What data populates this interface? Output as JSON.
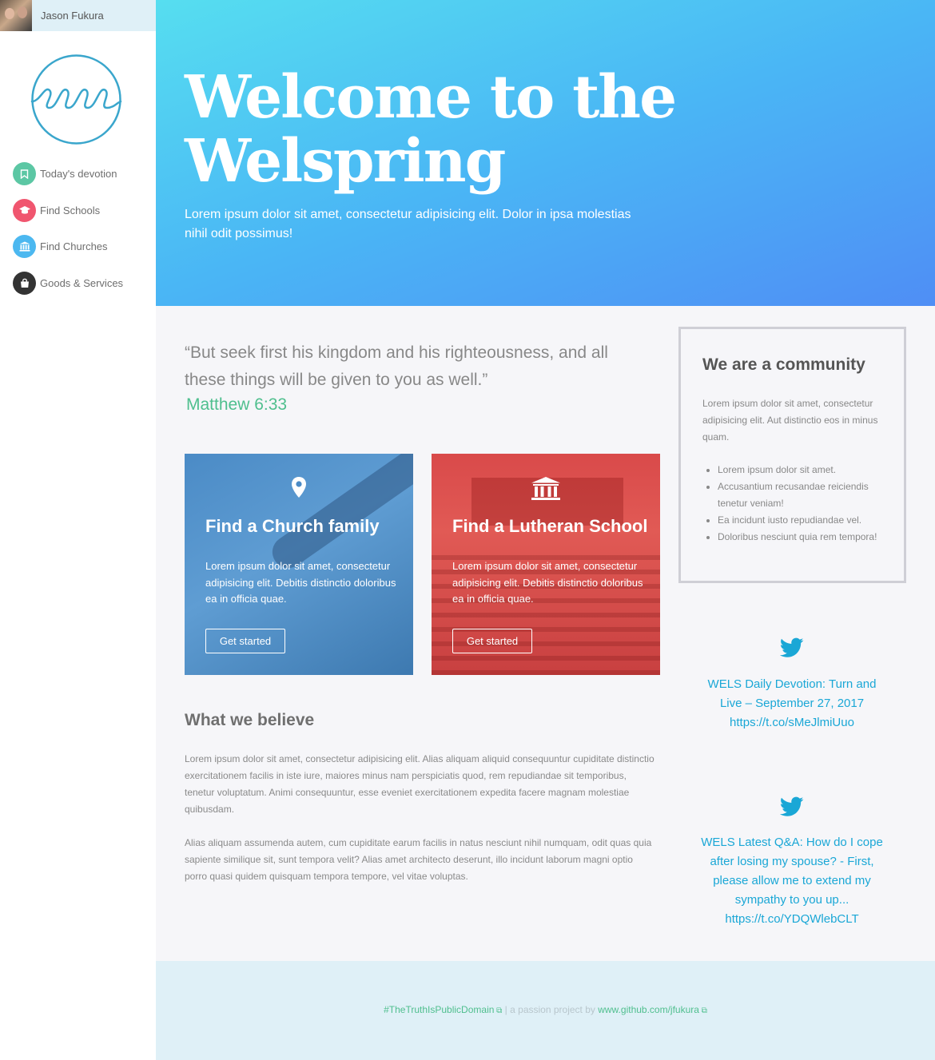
{
  "user": {
    "name": "Jason Fukura"
  },
  "nav": {
    "items": [
      {
        "label": "Today's devotion",
        "icon": "bookmark-icon",
        "color": "#5cc7a4"
      },
      {
        "label": "Find Schools",
        "icon": "graduation-cap-icon",
        "color": "#f0566f"
      },
      {
        "label": "Find Churches",
        "icon": "institution-icon",
        "color": "#4cb8f0"
      },
      {
        "label": "Goods & Services",
        "icon": "shopping-bag-icon",
        "color": "#333333"
      }
    ]
  },
  "hero": {
    "title_line1": "Welcome to the",
    "title_line2": "Welspring",
    "subtitle": "Lorem ipsum dolor sit amet, consectetur adipisicing elit. Dolor in ipsa molestias nihil odit possimus!"
  },
  "quote": {
    "text": "“But seek first his kingdom and his righteousness, and all these things will be given to you as well.”",
    "reference": "Matthew 6:33"
  },
  "cards": [
    {
      "title": "Find a Church family",
      "text": "Lorem ipsum dolor sit amet, consectetur adipisicing elit. Debitis distinctio doloribus ea in officia quae.",
      "button": "Get started",
      "icon": "map-marker-icon"
    },
    {
      "title": "Find a Lutheran School",
      "text": "Lorem ipsum dolor sit amet, consectetur adipisicing elit. Debitis distinctio doloribus ea in officia quae.",
      "button": "Get started",
      "icon": "institution-icon"
    }
  ],
  "believe": {
    "title": "What we believe",
    "p1": "Lorem ipsum dolor sit amet, consectetur adipisicing elit. Alias aliquam aliquid consequuntur cupiditate distinctio exercitationem facilis in iste iure, maiores minus nam perspiciatis quod, rem repudiandae sit temporibus, tenetur voluptatum. Animi consequuntur, esse eveniet exercitationem expedita facere magnam molestiae quibusdam.",
    "p2": "Alias aliquam assumenda autem, cum cupiditate earum facilis in natus nesciunt nihil numquam, odit quas quia sapiente similique sit, sunt tempora velit? Alias amet architecto deserunt, illo incidunt laborum magni optio porro quasi quidem quisquam tempora tempore, vel vitae voluptas."
  },
  "community": {
    "title": "We are a community",
    "text": "Lorem ipsum dolor sit amet, consectetur adipisicing elit. Aut distinctio eos in minus quam.",
    "list": [
      "Lorem ipsum dolor sit amet.",
      "Accusantium recusandae reiciendis tenetur veniam!",
      "Ea incidunt iusto repudiandae vel.",
      "Doloribus nesciunt quia rem tempora!"
    ]
  },
  "tweets": [
    {
      "text": "WELS Daily Devotion: Turn and Live – September 27, 2017 https://t.co/sMeJlmiUuo"
    },
    {
      "text": "WELS Latest Q&A: How do I cope after losing my spouse? - First, please allow me to extend my sympathy to you up... https://t.co/YDQWlebCLT"
    }
  ],
  "footer": {
    "hashtag": "#TheTruthIsPublicDomain",
    "separator": "|",
    "middle": "a passion project by",
    "link": "www.github.com/jfukura"
  },
  "colors": {
    "accent_green": "#4fbf8e",
    "tweet_blue": "#1aa7d6",
    "card_blue": "#4b8bc6",
    "card_red": "#d94a4a"
  }
}
